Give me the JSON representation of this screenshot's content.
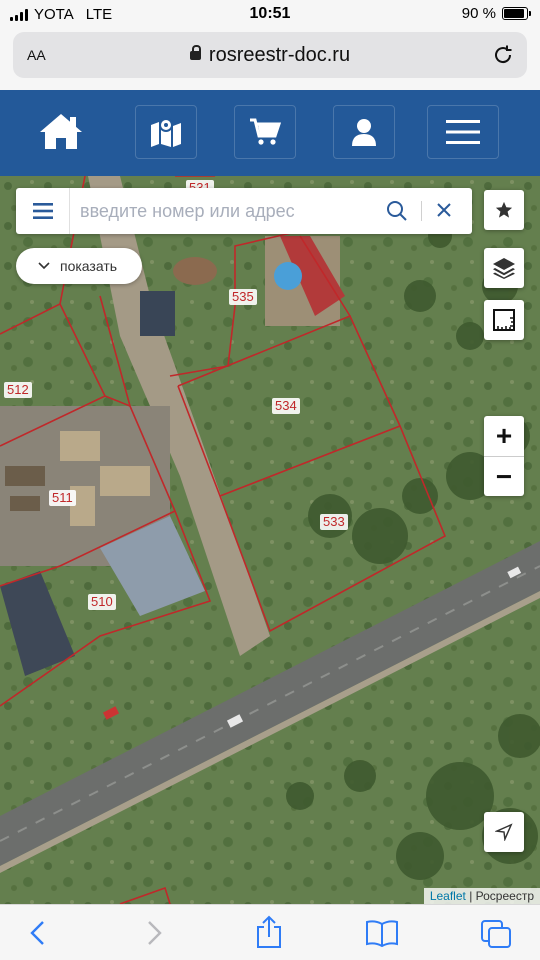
{
  "status_bar": {
    "carrier": "YOTA",
    "network": "LTE",
    "time": "10:51",
    "battery_percent": "90 %",
    "battery_level": 0.9
  },
  "address_bar": {
    "text_size_label": "AA",
    "url": "rosreestr-doc.ru"
  },
  "site_nav": {
    "icons": [
      "home-icon",
      "map-icon",
      "cart-icon",
      "user-icon",
      "hamburger-icon"
    ],
    "color": "#235999"
  },
  "map": {
    "search_placeholder": "введите номер или адрес",
    "show_button_label": "показать",
    "zoom_in_label": "+",
    "zoom_out_label": "−",
    "plots": [
      "531",
      "535",
      "512",
      "534",
      "511",
      "533",
      "510"
    ],
    "boundary_color": "#c0282a",
    "attribution": {
      "link": "Leaflet",
      "separator": " | ",
      "source": "Росреестр"
    }
  },
  "toolbar": {
    "icons": [
      "back-icon",
      "forward-icon",
      "share-icon",
      "bookmarks-icon",
      "tabs-icon"
    ]
  }
}
